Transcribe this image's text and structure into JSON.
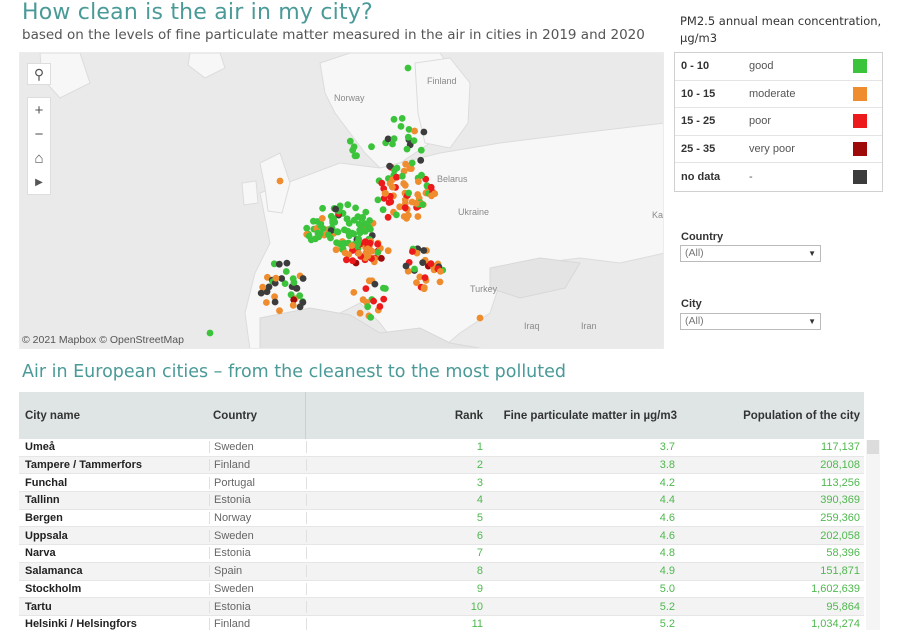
{
  "header": {
    "title": "How clean is the air in my city?",
    "subtitle": "based on the levels of fine particulate matter measured in the air in cities in 2019 and 2020"
  },
  "map": {
    "attribution": "© 2021 Mapbox © OpenStreetMap",
    "labels": [
      "Finland",
      "Norway",
      "Belarus",
      "Ukraine",
      "Turkey",
      "Iraq",
      "Iran",
      "Kaz"
    ],
    "controls": [
      "search-icon",
      "zoom-in-icon",
      "zoom-out-icon",
      "home-icon",
      "play-icon"
    ]
  },
  "legend": {
    "title": "PM2.5 annual mean concentration, µg/m3",
    "items": [
      {
        "range": "0 - 10",
        "name": "good",
        "color": "#3cc33c"
      },
      {
        "range": "10 - 15",
        "name": "moderate",
        "color": "#ee8c2e"
      },
      {
        "range": "15 - 25",
        "name": "poor",
        "color": "#ec1a1a"
      },
      {
        "range": "25 - 35",
        "name": "very poor",
        "color": "#9e0a0a"
      },
      {
        "range": "no data",
        "name": "-",
        "color": "#3c3c3c"
      }
    ]
  },
  "filters": {
    "country_label": "Country",
    "country_value": "(All)",
    "city_label": "City",
    "city_value": "(All)"
  },
  "table": {
    "title": "Air in European cities – from the cleanest to the most polluted",
    "headers": [
      "City name",
      "Country",
      "Rank",
      "Fine particulate matter in µg/m3",
      "Population of the city"
    ],
    "rows": [
      [
        "Umeå",
        "Sweden",
        "1",
        "3.7",
        "117,137"
      ],
      [
        "Tampere / Tammerfors",
        "Finland",
        "2",
        "3.8",
        "208,108"
      ],
      [
        "Funchal",
        "Portugal",
        "3",
        "4.2",
        "113,256"
      ],
      [
        "Tallinn",
        "Estonia",
        "4",
        "4.4",
        "390,369"
      ],
      [
        "Bergen",
        "Norway",
        "5",
        "4.6",
        "259,360"
      ],
      [
        "Uppsala",
        "Sweden",
        "6",
        "4.6",
        "202,058"
      ],
      [
        "Narva",
        "Estonia",
        "7",
        "4.8",
        "58,396"
      ],
      [
        "Salamanca",
        "Spain",
        "8",
        "4.9",
        "151,871"
      ],
      [
        "Stockholm",
        "Sweden",
        "9",
        "5.0",
        "1,602,639"
      ],
      [
        "Tartu",
        "Estonia",
        "10",
        "5.2",
        "95,864"
      ],
      [
        "Helsinki / Helsingfors",
        "Finland",
        "11",
        "5.2",
        "1,034,274"
      ]
    ]
  }
}
